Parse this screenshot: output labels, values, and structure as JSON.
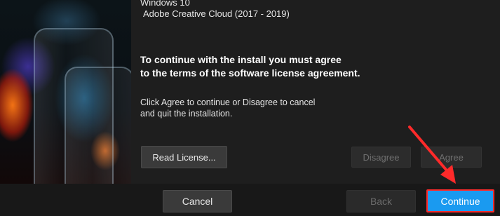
{
  "installer": {
    "os_text": "Windows 10",
    "product_text": "Adobe Creative Cloud (2017 - 2019)",
    "agreement_heading_line1": "To continue with the install you must agree",
    "agreement_heading_line2": "to the terms of the software license agreement.",
    "instructions_line1": "Click Agree to continue or Disagree to cancel",
    "instructions_line2": "and quit the installation.",
    "read_license_label": "Read License...",
    "disagree_label": "Disagree",
    "agree_label": "Agree"
  },
  "footer": {
    "cancel_label": "Cancel",
    "back_label": "Back",
    "continue_label": "Continue"
  },
  "colors": {
    "accent": "#1a9af0",
    "highlight": "#ff2a2a",
    "background": "#1e1e1e"
  }
}
